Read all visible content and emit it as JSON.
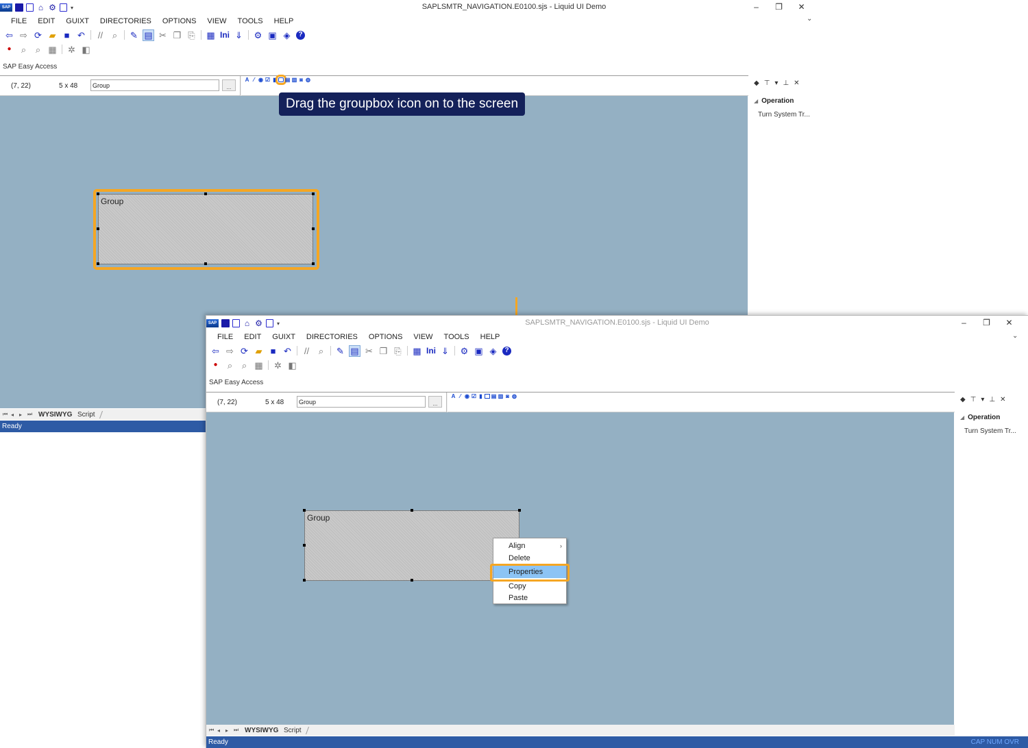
{
  "window": {
    "title": "SAPLSMTR_NAVIGATION.E0100.sjs - Liquid UI Demo",
    "controls": {
      "minimize": "–",
      "restore": "❐",
      "close": "✕",
      "expand": "⌄"
    }
  },
  "menu": [
    "FILE",
    "EDIT",
    "GUIXT",
    "DIRECTORIES",
    "OPTIONS",
    "VIEW",
    "TOOLS",
    "HELP"
  ],
  "toolbar": {
    "ini_label": "Ini"
  },
  "screen_label": "SAP Easy Access",
  "propbar": {
    "coord": "(7, 22)",
    "size": "5 x 48",
    "name_value": "Group",
    "browse": "..."
  },
  "right_pane": {
    "section": "Operation",
    "item": "Turn System Tr..."
  },
  "tabs": {
    "wysiwyg": "WYSIWYG",
    "script": "Script"
  },
  "status": {
    "text": "Ready",
    "indicators": "CAP NUM OVR"
  },
  "groupbox_label": "Group",
  "callout_text": "Drag the groupbox icon on to the screen",
  "context_menu": {
    "items": [
      "Align",
      "Delete",
      "Properties",
      "Copy",
      "Paste"
    ],
    "selected": "Properties"
  },
  "colors": {
    "highlight": "#f5a623",
    "canvas": "#94b0c3",
    "status_bar": "#2e5ba5",
    "callout_bg": "#14215a",
    "menu_selected": "#8cc4f5"
  }
}
